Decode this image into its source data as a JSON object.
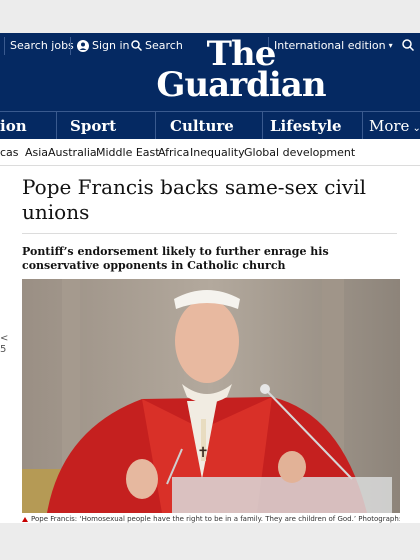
{
  "topbar": {
    "search_jobs": "Search jobs",
    "sign_in": "Sign in",
    "search": "Search",
    "edition": "International edition"
  },
  "logo": {
    "line1": "The",
    "line2": "Guardian"
  },
  "nav": {
    "partial": "ion",
    "sport": "Sport",
    "culture": "Culture",
    "lifestyle": "Lifestyle",
    "more": "More"
  },
  "subnav": [
    "cas",
    "Asia",
    "Australia",
    "Middle East",
    "Africa",
    "Inequality",
    "Global development"
  ],
  "article": {
    "headline": "Pope Francis backs same-sex civil unions",
    "standfirst": "Pontiff’s endorsement likely to further enrage his conservative opponents in Catholic church",
    "caption": "Pope Francis: ‘Homosexual people have the right to be in a family. They are children of God.’ Photograph: Vatican"
  },
  "edge": {
    "chevron": "<",
    "num": "5"
  },
  "colors": {
    "brand": "#052962",
    "accent": "#c70000"
  }
}
